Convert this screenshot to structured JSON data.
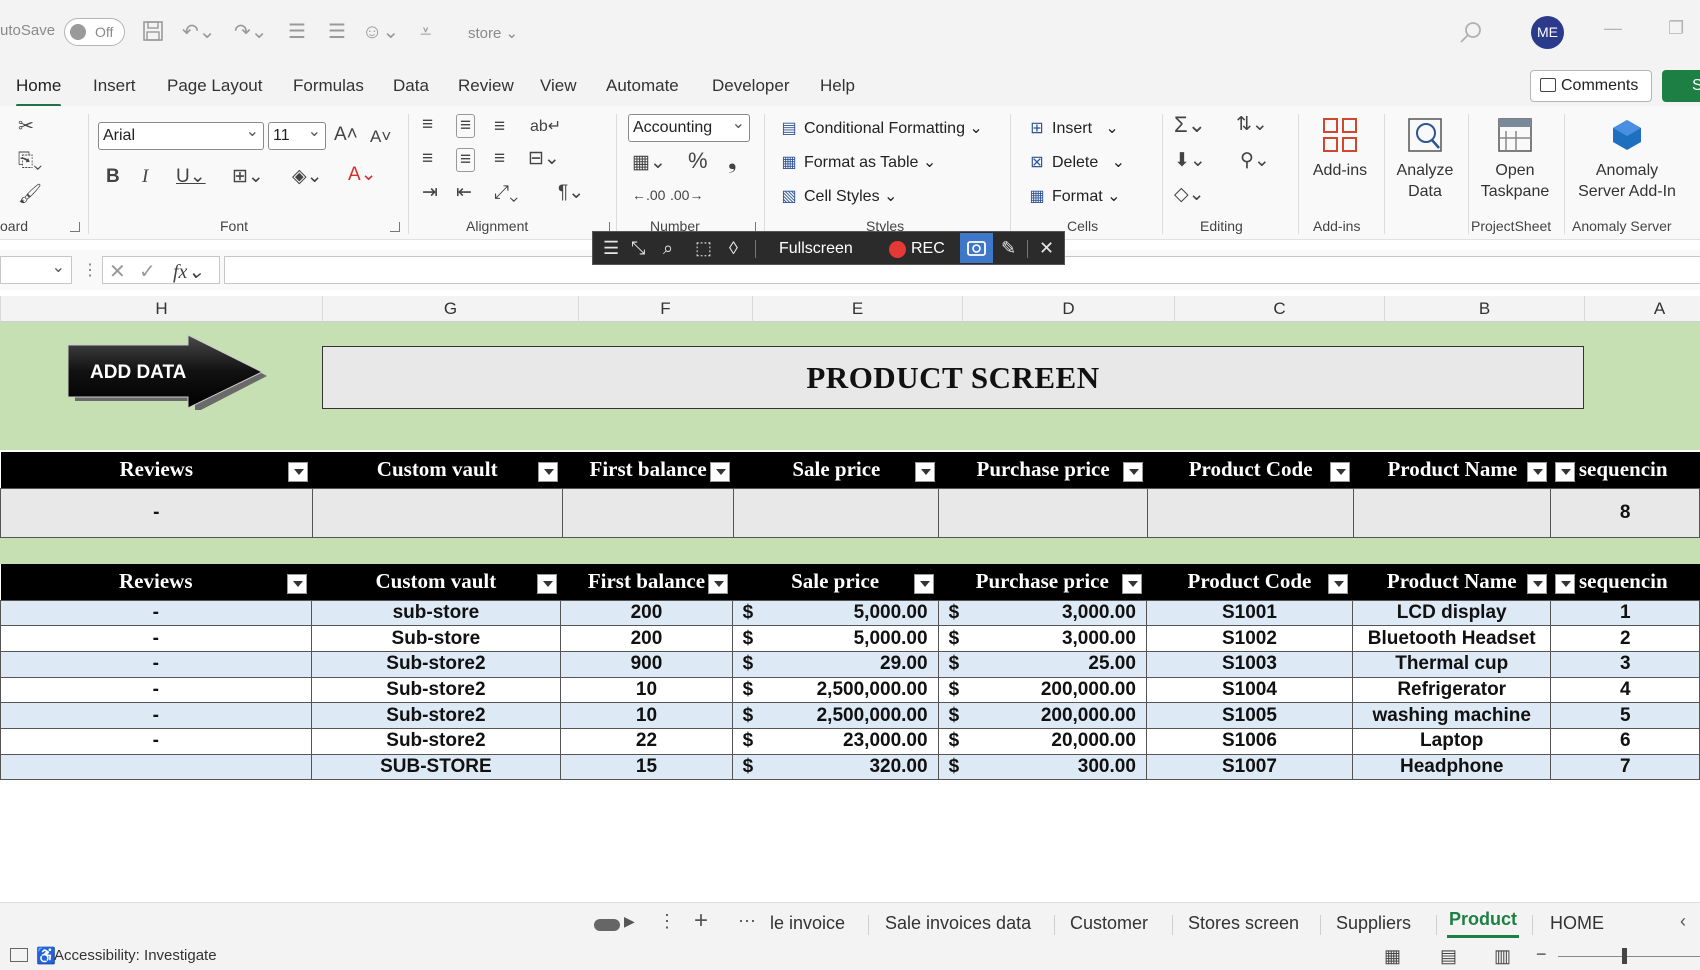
{
  "titlebar": {
    "autosave_label": "utoSave",
    "toggle_state": "Off",
    "file_name": "store",
    "avatar_initials": "ME"
  },
  "menu": {
    "tabs": [
      "Home",
      "Insert",
      "Page Layout",
      "Formulas",
      "Data",
      "Review",
      "View",
      "Automate",
      "Developer",
      "Help"
    ],
    "active": "Home",
    "comments_label": "Comments",
    "share_label": "S"
  },
  "ribbon": {
    "font_name": "Arial",
    "font_size": "11",
    "number_format": "Accounting",
    "conditional_formatting": "Conditional Formatting",
    "format_as_table": "Format as Table",
    "cell_styles": "Cell Styles",
    "insert": "Insert",
    "delete": "Delete",
    "format": "Format",
    "addins_label": "Add-ins",
    "analyze_line1": "Analyze",
    "analyze_line2": "Data",
    "open_line1": "Open",
    "open_line2": "Taskpane",
    "anomaly_line1": "Anomaly",
    "anomaly_line2": "Server Add-In",
    "groups": {
      "clipboard": "oard",
      "font": "Font",
      "alignment": "Alignment",
      "number": "Number",
      "styles": "Styles",
      "cells": "Cells",
      "editing": "Editing",
      "addins": "Add-ins",
      "projectsheet": "ProjectSheet",
      "anomaly": "Anomaly Server"
    }
  },
  "floatbar": {
    "fullscreen_label": "Fullscreen",
    "rec_label": "REC",
    "rec_color": "#e53935"
  },
  "formula": {
    "fx_label": "fx"
  },
  "columns": [
    "H",
    "G",
    "F",
    "E",
    "D",
    "C",
    "B",
    "A"
  ],
  "sheet": {
    "add_data_label": "ADD DATA",
    "title": "PRODUCT SCREEN",
    "headers": [
      "Reviews",
      "Custom vault",
      "First balance",
      "Sale price",
      "Purchase price",
      "Product Code",
      "Product Name",
      "sequencin"
    ],
    "input_row": {
      "reviews": "-",
      "custom_vault": "",
      "first_balance": "",
      "sale_price": "",
      "purchase_price": "",
      "product_code": "",
      "product_name": "",
      "sequence": "8"
    },
    "currency_symbol": "$",
    "rows": [
      {
        "reviews": "-",
        "custom_vault": "sub-store",
        "first_balance": "200",
        "sale_price": "5,000.00",
        "purchase_price": "3,000.00",
        "product_code": "S1001",
        "product_name": "LCD display",
        "sequence": "1"
      },
      {
        "reviews": "-",
        "custom_vault": "Sub-store",
        "first_balance": "200",
        "sale_price": "5,000.00",
        "purchase_price": "3,000.00",
        "product_code": "S1002",
        "product_name": "Bluetooth Headset",
        "sequence": "2"
      },
      {
        "reviews": "-",
        "custom_vault": "Sub-store2",
        "first_balance": "900",
        "sale_price": "29.00",
        "purchase_price": "25.00",
        "product_code": "S1003",
        "product_name": "Thermal cup",
        "sequence": "3"
      },
      {
        "reviews": "-",
        "custom_vault": "Sub-store2",
        "first_balance": "10",
        "sale_price": "2,500,000.00",
        "purchase_price": "200,000.00",
        "product_code": "S1004",
        "product_name": "Refrigerator",
        "sequence": "4"
      },
      {
        "reviews": "-",
        "custom_vault": "Sub-store2",
        "first_balance": "10",
        "sale_price": "2,500,000.00",
        "purchase_price": "200,000.00",
        "product_code": "S1005",
        "product_name": "washing machine",
        "sequence": "5"
      },
      {
        "reviews": "-",
        "custom_vault": "Sub-store2",
        "first_balance": "22",
        "sale_price": "23,000.00",
        "purchase_price": "20,000.00",
        "product_code": "S1006",
        "product_name": "Laptop",
        "sequence": "6"
      },
      {
        "reviews": "",
        "custom_vault": "SUB-STORE",
        "first_balance": "15",
        "sale_price": "320.00",
        "purchase_price": "300.00",
        "product_code": "S1007",
        "product_name": "Headphone",
        "sequence": "7"
      }
    ]
  },
  "sheet_tabs": {
    "tabs": [
      "le invoice",
      "Sale invoices data",
      "Customer",
      "Stores screen",
      "Suppliers",
      "Product",
      "HOME"
    ],
    "active": "Product"
  },
  "status": {
    "accessibility": "Accessibility: Investigate"
  },
  "colors": {
    "accent_green": "#1e7f45",
    "band_green": "#c6e0b4",
    "row_blue": "#dde9f5"
  }
}
